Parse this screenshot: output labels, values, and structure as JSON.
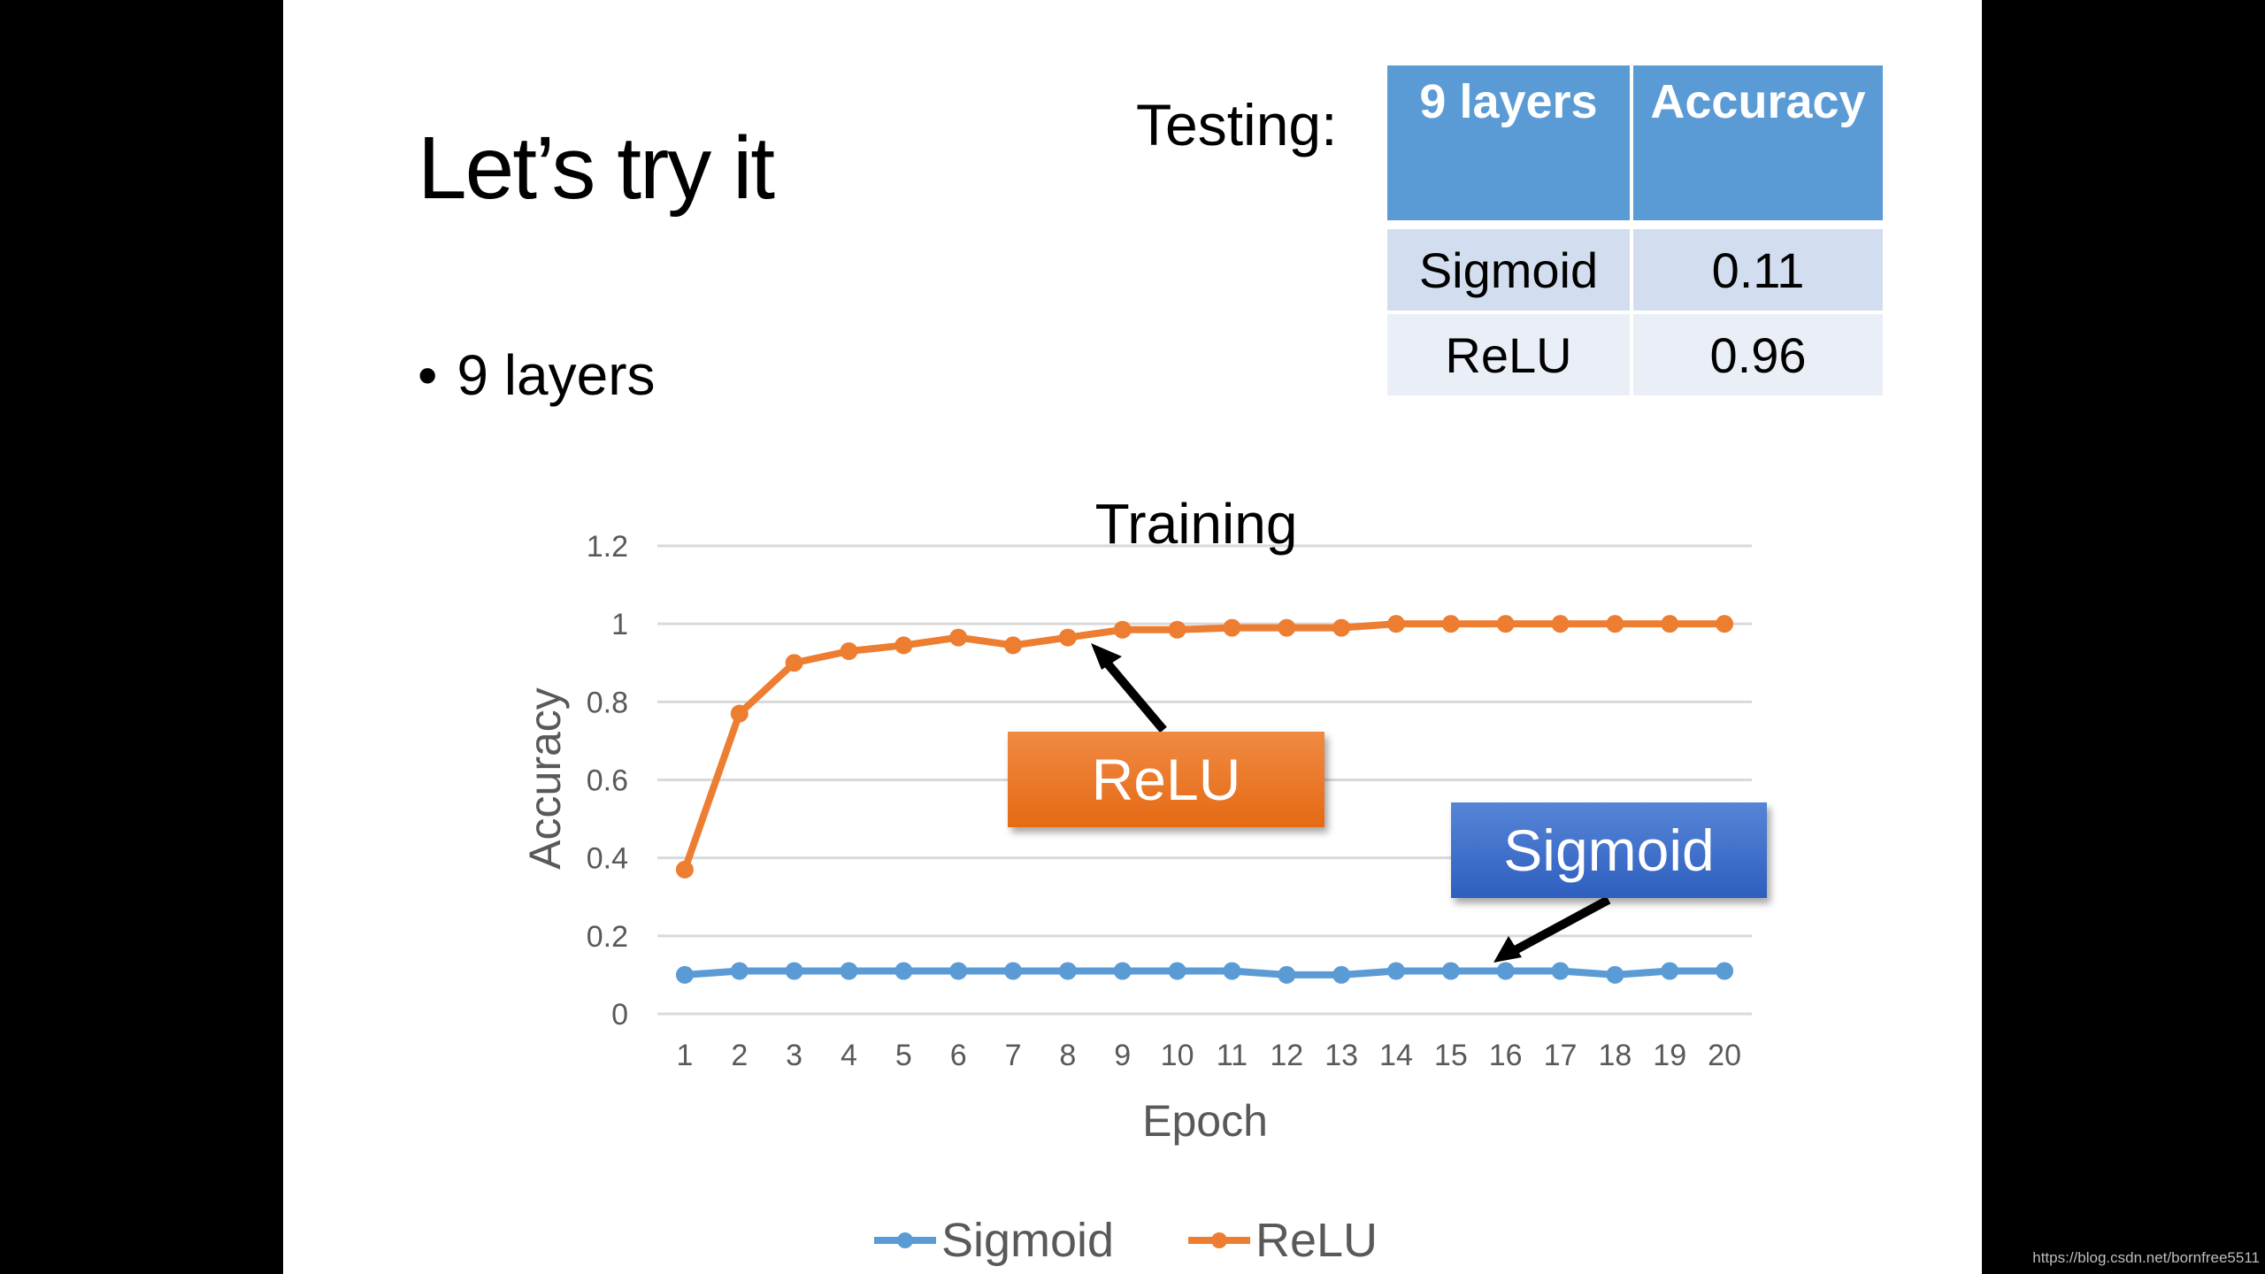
{
  "slide": {
    "title": "Let’s try it",
    "bullet": "9 layers",
    "bullet_marker": "•",
    "testing_label": "Testing:"
  },
  "results_table": {
    "headers": [
      "9 layers",
      "Accuracy"
    ],
    "rows": [
      {
        "name": "Sigmoid",
        "accuracy": "0.11"
      },
      {
        "name": "ReLU",
        "accuracy": "0.96"
      }
    ]
  },
  "callouts": {
    "relu": "ReLU",
    "sigmoid": "Sigmoid"
  },
  "watermark": "https://blog.csdn.net/bornfree5511",
  "colors": {
    "sigmoid": "#5b9bd5",
    "relu": "#ed7d31",
    "header": "#5b9bd5",
    "grid": "#d9d9d9",
    "axis_text": "#595959"
  },
  "chart_data": {
    "type": "line",
    "title": "Training",
    "xlabel": "Epoch",
    "ylabel": "Accuracy",
    "x": [
      1,
      2,
      3,
      4,
      5,
      6,
      7,
      8,
      9,
      10,
      11,
      12,
      13,
      14,
      15,
      16,
      17,
      18,
      19,
      20
    ],
    "yticks": [
      "0",
      "0.2",
      "0.4",
      "0.6",
      "0.8",
      "1",
      "1.2"
    ],
    "ytick_values": [
      0,
      0.2,
      0.4,
      0.6,
      0.8,
      1.0,
      1.2
    ],
    "ylim": [
      0,
      1.2
    ],
    "grid": true,
    "legend_position": "bottom",
    "series": [
      {
        "name": "Sigmoid",
        "color": "#5b9bd5",
        "values": [
          0.1,
          0.11,
          0.11,
          0.11,
          0.11,
          0.11,
          0.11,
          0.11,
          0.11,
          0.11,
          0.11,
          0.1,
          0.1,
          0.11,
          0.11,
          0.11,
          0.11,
          0.1,
          0.11,
          0.11
        ]
      },
      {
        "name": "ReLU",
        "color": "#ed7d31",
        "values": [
          0.37,
          0.77,
          0.9,
          0.93,
          0.945,
          0.965,
          0.945,
          0.965,
          0.985,
          0.985,
          0.99,
          0.99,
          0.99,
          1.0,
          1.0,
          1.0,
          1.0,
          1.0,
          1.0,
          1.0
        ]
      }
    ]
  }
}
